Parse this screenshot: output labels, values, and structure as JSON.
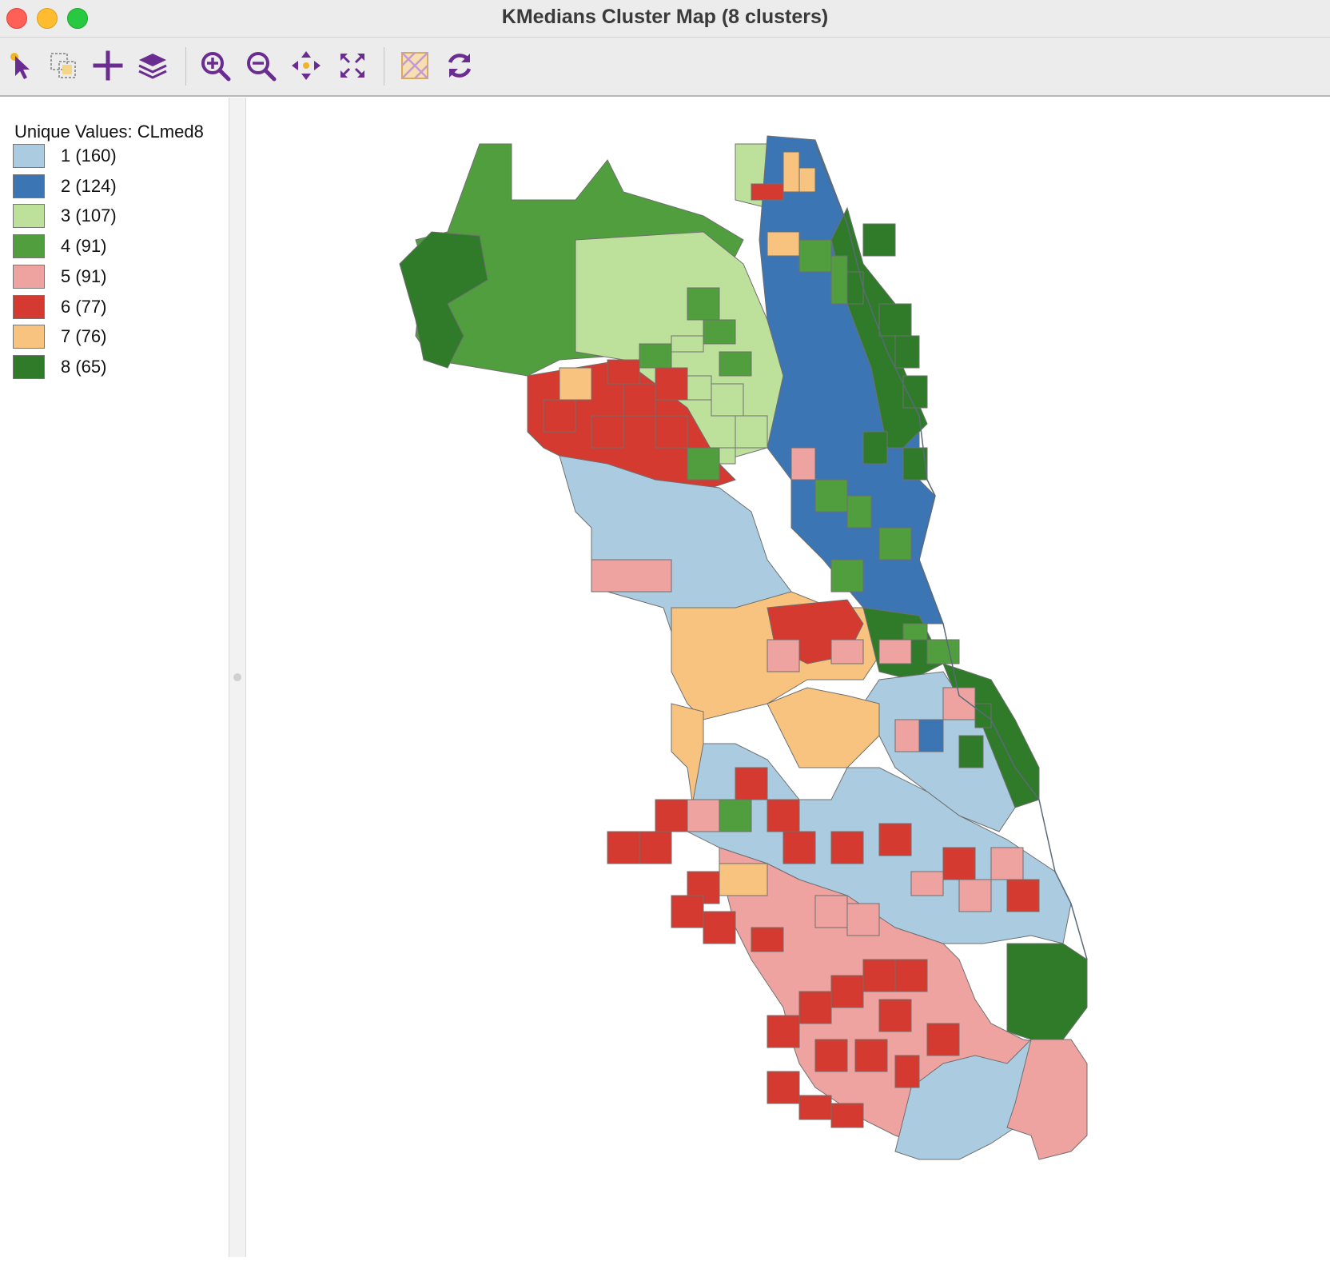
{
  "window": {
    "title": "KMedians Cluster Map (8 clusters)"
  },
  "toolbar": {
    "tools": [
      {
        "name": "select-tool",
        "icon": "pointer-icon"
      },
      {
        "name": "selection-shape-tool",
        "icon": "selection-copy-icon"
      },
      {
        "name": "add-layer-tool",
        "icon": "plus-icon"
      },
      {
        "name": "layers-tool",
        "icon": "layers-icon"
      },
      {
        "name": "zoom-in-tool",
        "icon": "zoom-in-icon"
      },
      {
        "name": "zoom-out-tool",
        "icon": "zoom-out-icon"
      },
      {
        "name": "pan-tool",
        "icon": "move-icon"
      },
      {
        "name": "full-extent-tool",
        "icon": "fit-extent-icon"
      },
      {
        "name": "basemap-tool",
        "icon": "basemap-icon"
      },
      {
        "name": "refresh-tool",
        "icon": "refresh-icon"
      }
    ],
    "icon_color": "#6a2c91"
  },
  "legend": {
    "title": "Unique Values: CLmed8",
    "items": [
      {
        "label": "1 (160)",
        "color": "#abcbe0"
      },
      {
        "label": "2 (124)",
        "color": "#3b75b4"
      },
      {
        "label": "3 (107)",
        "color": "#bde19b"
      },
      {
        "label": "4 (91)",
        "color": "#509e3e"
      },
      {
        "label": "5 (91)",
        "color": "#eea3a1"
      },
      {
        "label": "6 (77)",
        "color": "#d43a2f"
      },
      {
        "label": "7 (76)",
        "color": "#f7c37e"
      },
      {
        "label": "8 (65)",
        "color": "#2f7b2a"
      }
    ]
  }
}
